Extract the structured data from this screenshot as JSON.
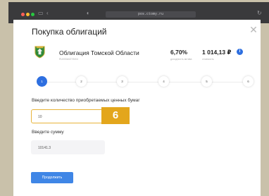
{
  "browser": {
    "url": "pos.ctomy.ru",
    "tab_label": "Покупка",
    "back_icon": "chevron-left-icon",
    "sidebar_icon": "sidebar-icon",
    "shield_icon": "shield-icon",
    "reload_icon": "reload-icon"
  },
  "modal": {
    "title": "Покупка облигаций",
    "close_glyph": "✕",
    "close_icon": "close-icon"
  },
  "bond": {
    "logo_icon": "coat-of-arms-icon",
    "name": "Облигация Томской Области",
    "code": "RU000A0ZYMX4",
    "yield_value": "6,70%",
    "yield_label": "доходность актива",
    "price_value": "1 014,13 ₽",
    "price_label": "стоимость",
    "info_glyph": "i"
  },
  "steps": [
    "1",
    "2",
    "3",
    "4",
    "5",
    "6"
  ],
  "active_step": 1,
  "form": {
    "quantity_label": "Введите количество приобретаемых ценных бумаг",
    "quantity_value": "10",
    "sum_label": "Введите сумму",
    "sum_value": "10141.3",
    "badge": "6"
  },
  "actions": {
    "continue_label": "Продолжить"
  },
  "colors": {
    "accent": "#2e6fe0",
    "button": "#3f86e6",
    "highlight": "#e3a61c",
    "page_background": "#c9c1aa"
  }
}
